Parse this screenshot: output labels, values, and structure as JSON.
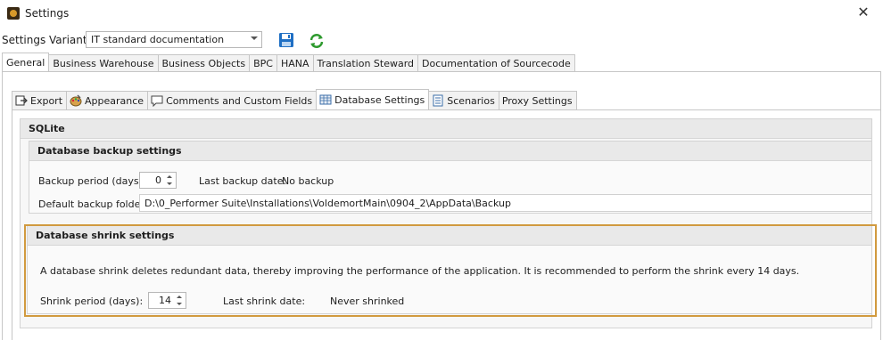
{
  "window": {
    "title": "Settings",
    "close_glyph": "✕"
  },
  "variant": {
    "label": "Settings Variant:",
    "value": "IT standard documentation"
  },
  "toolbar": {
    "save_icon": "floppy-disk-icon",
    "refresh_icon": "refresh-icon"
  },
  "top_tabs": [
    {
      "label": "General",
      "active": true
    },
    {
      "label": "Business Warehouse",
      "active": false
    },
    {
      "label": "Business Objects",
      "active": false
    },
    {
      "label": "BPC",
      "active": false
    },
    {
      "label": "HANA",
      "active": false
    },
    {
      "label": "Translation Steward",
      "active": false
    },
    {
      "label": "Documentation of Sourcecode",
      "active": false
    }
  ],
  "sub_tabs": [
    {
      "label": "Export",
      "icon": "export-icon",
      "active": false
    },
    {
      "label": "Appearance",
      "icon": "palette-icon",
      "active": false
    },
    {
      "label": "Comments and Custom Fields",
      "icon": "comment-icon",
      "active": false
    },
    {
      "label": "Database Settings",
      "icon": "database-icon",
      "active": true
    },
    {
      "label": "Scenarios",
      "icon": "list-icon",
      "active": false
    },
    {
      "label": "Proxy Settings",
      "icon": "",
      "active": false
    }
  ],
  "sqlite": {
    "title": "SQLite",
    "backup": {
      "title": "Database backup settings",
      "period_label": "Backup period (days):",
      "period_value": "0",
      "last_label": "Last backup date:",
      "last_value": "No backup",
      "folder_label": "Default backup folder",
      "folder_value": "D:\\0_Performer Suite\\Installations\\VoldemortMain\\0904_2\\AppData\\Backup"
    },
    "shrink": {
      "title": "Database shrink settings",
      "description": "A database shrink deletes redundant data, thereby improving the performance of the application. It is recommended to perform the shrink every 14 days.",
      "period_label": "Shrink period (days):",
      "period_value": "14",
      "last_label": "Last shrink date:",
      "last_value": "Never shrinked"
    }
  },
  "colors": {
    "highlight": "#d19a3f",
    "save_blue": "#1f6fc4",
    "refresh_green": "#2e9a2e"
  }
}
